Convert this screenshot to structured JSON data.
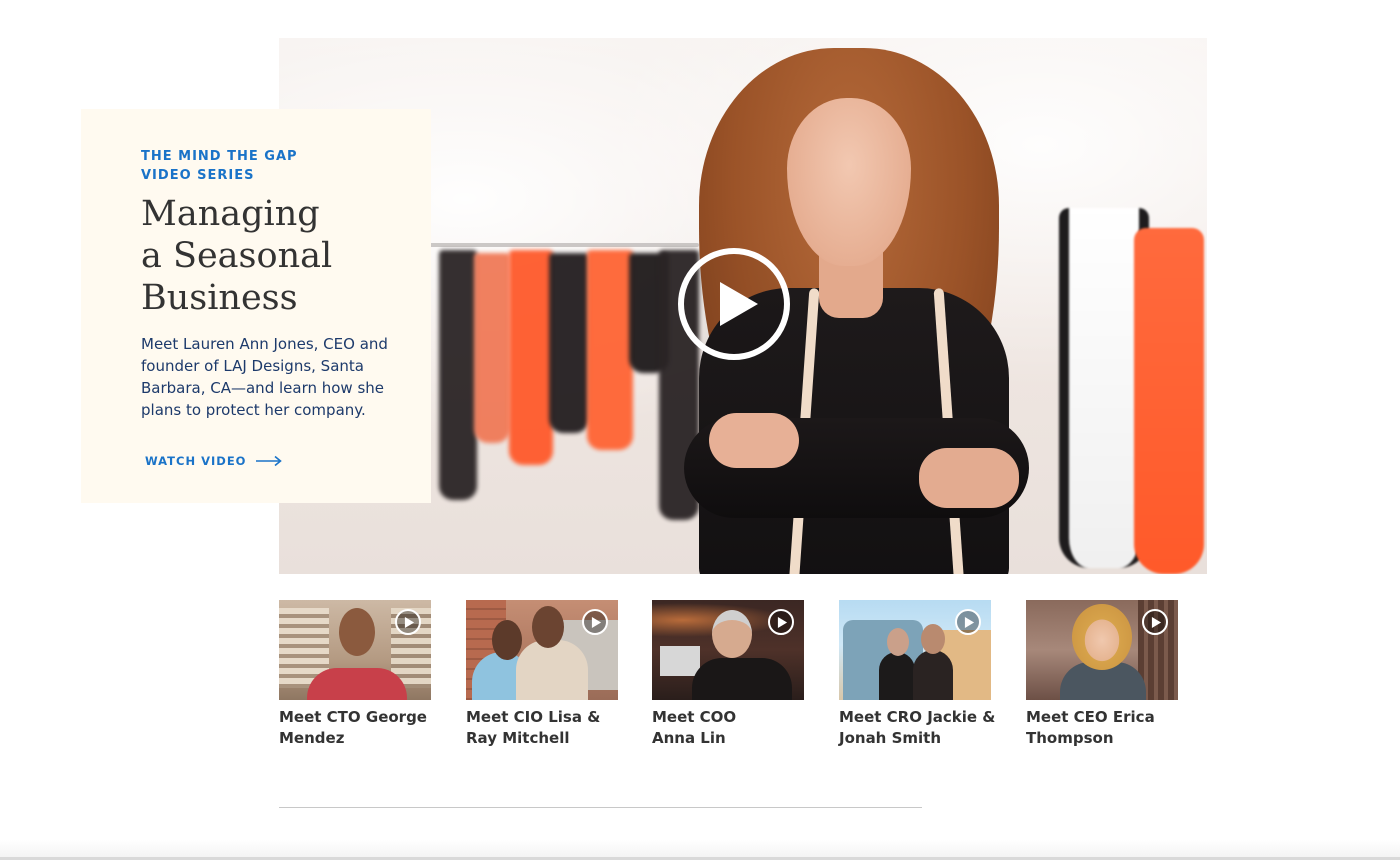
{
  "feature": {
    "eyebrow_line1": "THE MIND THE GAP",
    "eyebrow_line2": "VIDEO SERIES",
    "title_line1": "Managing",
    "title_line2": "a Seasonal",
    "title_line3": "Business",
    "description": "Meet Lauren Ann Jones, CEO and founder of LAJ Designs, Santa Barbara, CA—and learn how she plans to protect her company.",
    "cta_label": "WATCH VIDEO",
    "cta_icon": "arrow-right-icon",
    "hero_icon": "play-icon"
  },
  "thumbnails": [
    {
      "caption_line1": "Meet CTO George",
      "caption_line2": "Mendez",
      "icon": "play-icon"
    },
    {
      "caption_line1": "Meet CIO Lisa &",
      "caption_line2": "Ray Mitchell",
      "icon": "play-icon"
    },
    {
      "caption_line1": "Meet COO",
      "caption_line2": "Anna Lin",
      "icon": "play-icon"
    },
    {
      "caption_line1": "Meet CRO Jackie &",
      "caption_line2": "Jonah Smith",
      "icon": "play-icon"
    },
    {
      "caption_line1": "Meet CEO Erica",
      "caption_line2": "Thompson",
      "icon": "play-icon"
    }
  ],
  "colors": {
    "accent_blue": "#1a73c8",
    "card_background": "#fffaf0",
    "title_text": "#333333",
    "description_text": "#1d3a6b"
  }
}
